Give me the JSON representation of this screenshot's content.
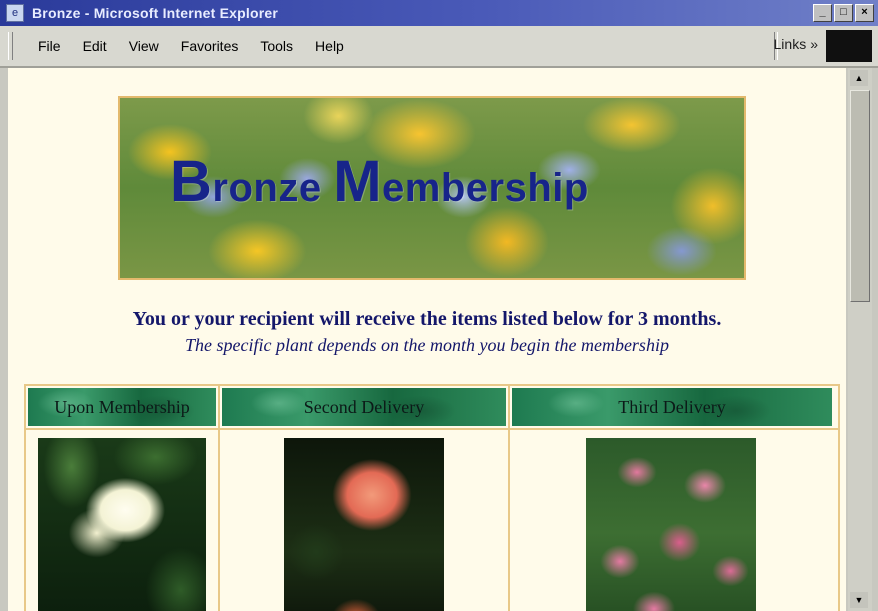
{
  "window": {
    "title": "Bronze - Microsoft Internet Explorer",
    "controls": [
      "_",
      "□",
      "×"
    ]
  },
  "menu": {
    "items": [
      "File",
      "Edit",
      "View",
      "Favorites",
      "Tools",
      "Help"
    ],
    "links_label": "Links",
    "links_chevron": "»"
  },
  "page": {
    "banner_title_first_cap": "B",
    "banner_title_first_rest": "ronze ",
    "banner_title_second_cap": "M",
    "banner_title_second_rest": "embership",
    "heading": "You or your recipient will receive the items listed below for 3 months.",
    "subheading": "The specific plant depends on the month you begin the membership",
    "columns": [
      "Upon Membership",
      "Second Delivery",
      "Third Delivery"
    ]
  },
  "icons": {
    "app": "ie-page-icon",
    "photos": [
      "gardenia-photo",
      "rose-photo",
      "lily-photo"
    ]
  }
}
